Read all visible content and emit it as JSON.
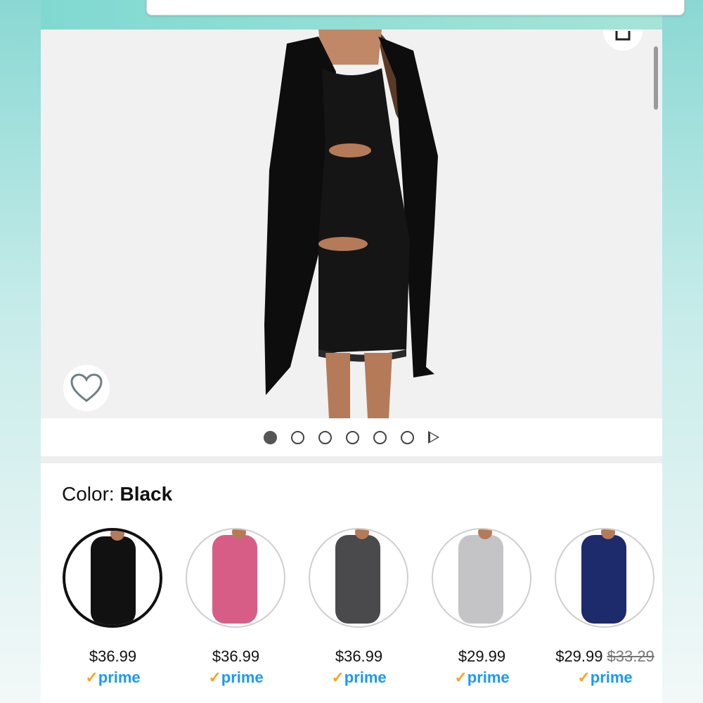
{
  "colors": {
    "prime_blue": "#1a98ff",
    "prime_check": "#f5a623",
    "selected_border": "#111111"
  },
  "product": {
    "image_count": 6,
    "active_image_index": 0
  },
  "color_selector": {
    "label": "Color: ",
    "selected": "Black"
  },
  "variants": [
    {
      "color": "Black",
      "swatch_hex": "#111111",
      "price": "$36.99",
      "old_price": "",
      "prime": "prime"
    },
    {
      "color": "Pink",
      "swatch_hex": "#d85d86",
      "price": "$36.99",
      "old_price": "",
      "prime": "prime"
    },
    {
      "color": "Dark Gray",
      "swatch_hex": "#4a4a4c",
      "price": "$36.99",
      "old_price": "",
      "prime": "prime"
    },
    {
      "color": "Light Gray",
      "swatch_hex": "#c4c4c6",
      "price": "$29.99",
      "old_price": "",
      "prime": "prime"
    },
    {
      "color": "Navy",
      "swatch_hex": "#1d2a6b",
      "price": "$29.99",
      "old_price": "$33.29",
      "prime": "prime"
    }
  ],
  "icons": {
    "share": "share-icon",
    "favorite": "heart-icon",
    "play": "play-icon",
    "prime_check": "check-icon"
  }
}
